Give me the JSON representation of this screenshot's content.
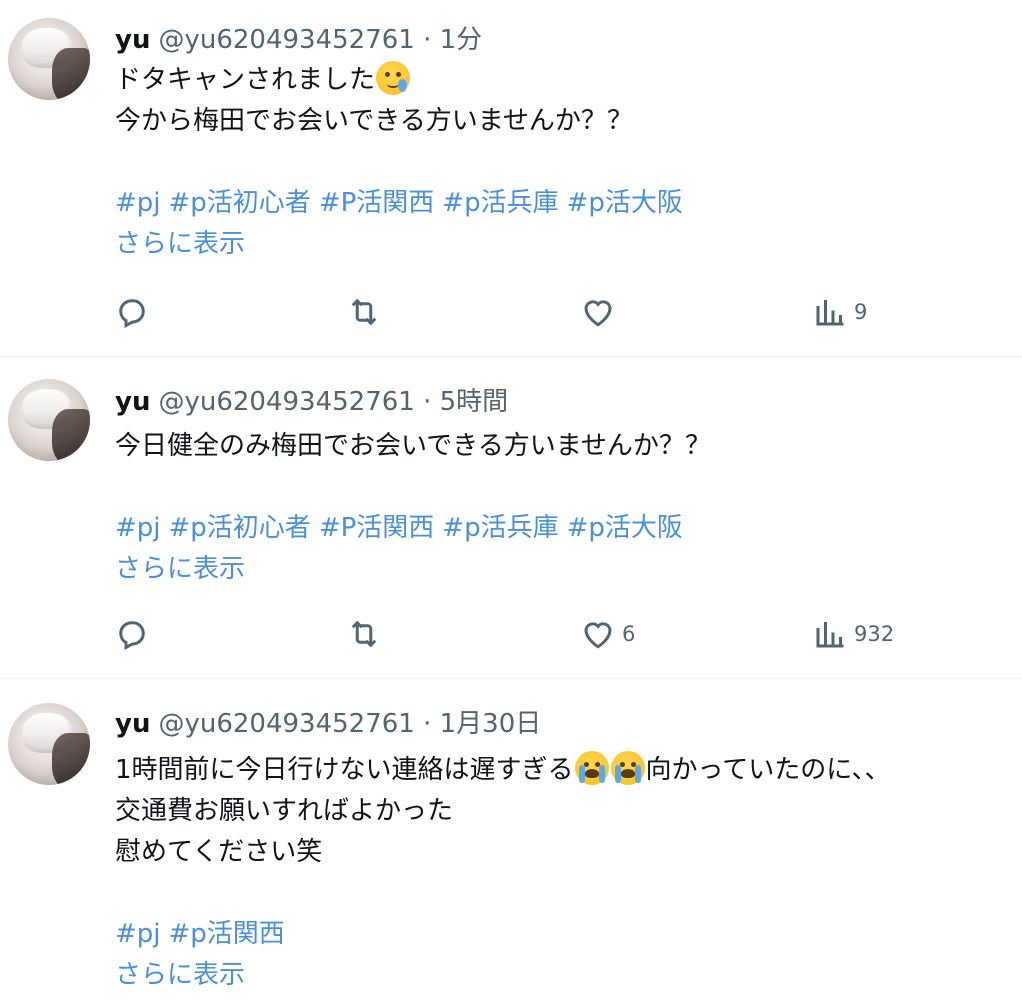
{
  "tweets": [
    {
      "name": "yu",
      "handle": "@yu620493452761",
      "separator": "·",
      "time": "1分",
      "lines": [
        "ドタキャンされました",
        "今から梅田でお会いできる方いませんか？？"
      ],
      "hashtags": [
        "#pj",
        "#p活初心者",
        "#P活関西",
        "#p活兵庫",
        "#p活大阪"
      ],
      "more": "さらに表示",
      "likes": "",
      "views": "9"
    },
    {
      "name": "yu",
      "handle": "@yu620493452761",
      "separator": "·",
      "time": "5時間",
      "lines": [
        "今日健全のみ梅田でお会いできる方いませんか？？"
      ],
      "hashtags": [
        "#pj",
        "#p活初心者",
        "#P活関西",
        "#p活兵庫",
        "#p活大阪"
      ],
      "more": "さらに表示",
      "likes": "6",
      "views": "932"
    },
    {
      "name": "yu",
      "handle": "@yu620493452761",
      "separator": "·",
      "time": "1月30日",
      "line1_a": "1時間前に今日行けない連絡は遅すぎる",
      "line1_b": "向かっていたのに、、",
      "lines": [
        "交通費お願いすればよかった",
        "慰めてください笑"
      ],
      "hashtags": [
        "#pj",
        "#p活関西"
      ],
      "more": "さらに表示"
    }
  ],
  "icons": {
    "reply": "reply-icon",
    "retweet": "retweet-icon",
    "like": "heart-icon",
    "views": "views-icon",
    "emoji_tear": "face-holding-back-tears-icon",
    "emoji_cry": "loudly-crying-face-icon"
  },
  "colors": {
    "link": "#4a90d9",
    "muted": "#536471",
    "divider": "#eff3f4"
  }
}
